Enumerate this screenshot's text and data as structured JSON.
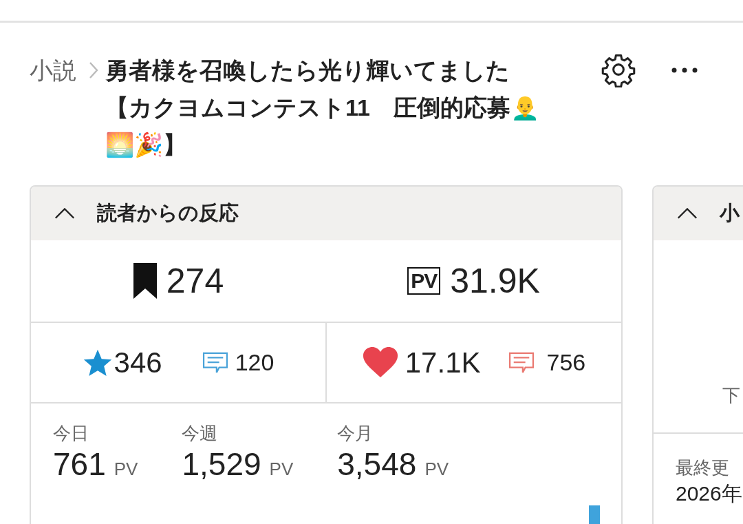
{
  "breadcrumb": {
    "category": "小説",
    "title": "勇者様を召喚したら光り輝いてました【カクヨムコンテスト11　圧倒的応募👨‍🦲🌅🎉】"
  },
  "reactions_card": {
    "title": "読者からの反応",
    "expanded": true,
    "follows": "274",
    "pv_label": "PV",
    "pv_total": "31.9K",
    "stars": "346",
    "star_reviews": "120",
    "hearts": "17.1K",
    "comments": "756",
    "periods": [
      {
        "label": "今日",
        "value": "761",
        "unit": "PV"
      },
      {
        "label": "今週",
        "value": "1,529",
        "unit": "PV"
      },
      {
        "label": "今月",
        "value": "3,548",
        "unit": "PV"
      }
    ]
  },
  "side_card": {
    "title": "小",
    "expanded": true,
    "row_text": "下",
    "updated_label": "最終更",
    "updated_value": "2026年"
  }
}
